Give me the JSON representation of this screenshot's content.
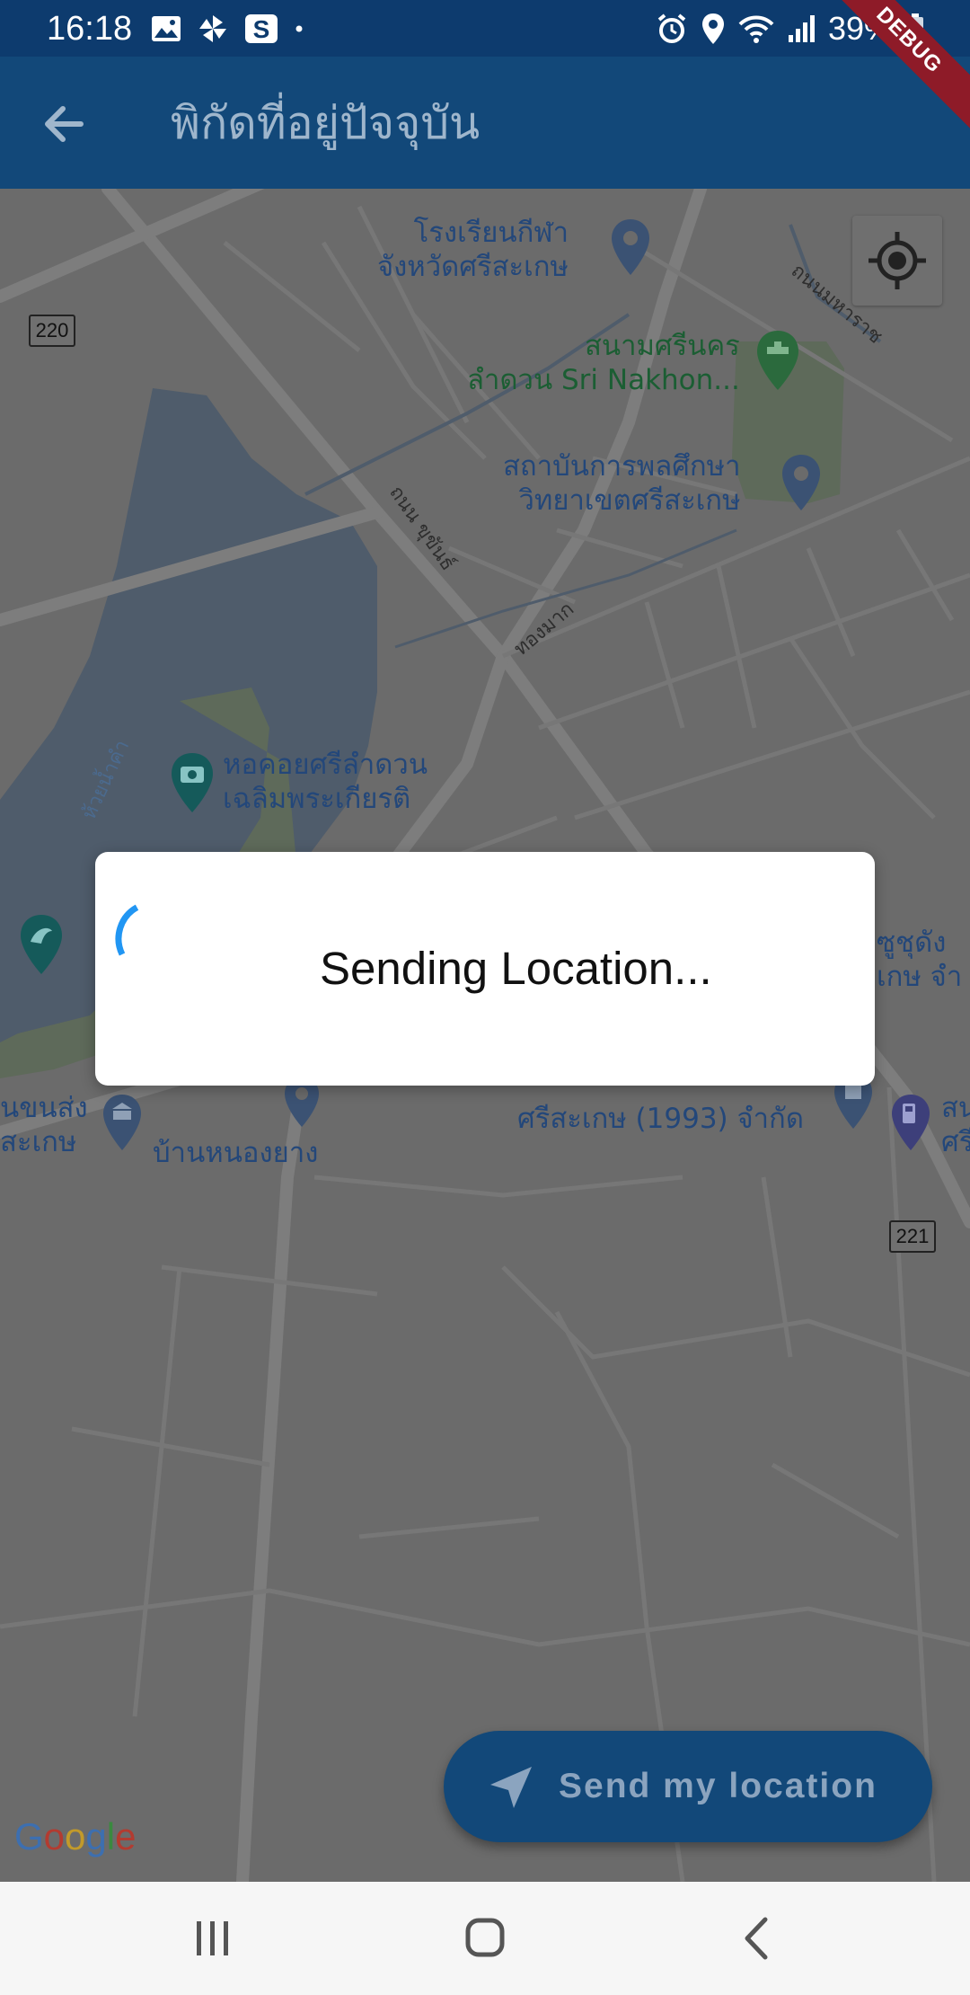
{
  "status_bar": {
    "time": "16:18",
    "battery": "39%",
    "icons_left": [
      "image-icon",
      "pinwheel-icon",
      "s-app-icon",
      "dot-icon"
    ],
    "icons_right": [
      "alarm-icon",
      "location-icon",
      "wifi-icon",
      "signal-icon",
      "battery-icon"
    ]
  },
  "debug_banner": "DEBUG",
  "app_bar": {
    "title": "พิกัดที่อยู่ปัจจุบัน",
    "back_icon": "arrow-back-icon"
  },
  "map": {
    "places": [
      {
        "name": "โรงเรียนกีฬา\nจังหวัดศรีสะเกษ"
      },
      {
        "name": "สนามศรีนคร\nลำดวน Sri Nakhon..."
      },
      {
        "name": "สถาบันการพลศึกษา\nวิทยาเขตศรีสะเกษ"
      },
      {
        "name": "หอคอยศรีลำดวน\nเฉลิมพระเกียรติ"
      },
      {
        "name": "บ้านหนองยาง"
      },
      {
        "name": "ศรีสะเกษ (1993) จำกัด"
      },
      {
        "name": "นขนส่ง\nสะเกษ"
      },
      {
        "name": "ซูชุดัง\nเกษ จำ"
      },
      {
        "name": "สน\nศรี"
      }
    ],
    "roads": [
      "ถนนมหาราช",
      "ถนน ขุขันธ์",
      "ทองมาก",
      "ห้วยน้ำคำ"
    ],
    "highway_shields": [
      "220",
      "221"
    ],
    "my_location_icon": "my-location-icon",
    "attribution": [
      "G",
      "o",
      "o",
      "g",
      "l",
      "e"
    ]
  },
  "dialog": {
    "message": "Sending Location...",
    "spinner_progress": 0.15
  },
  "send_button": {
    "label": "Send my location",
    "icon": "navigation-arrow-icon"
  },
  "nav_bar": {
    "recents": "recents-icon",
    "home": "home-icon",
    "back": "back-icon"
  },
  "colors": {
    "primary": "#124879",
    "status_bar": "#0d3b6e",
    "spinner": "#2196f3",
    "scrim_map": "#6b6b6b"
  }
}
